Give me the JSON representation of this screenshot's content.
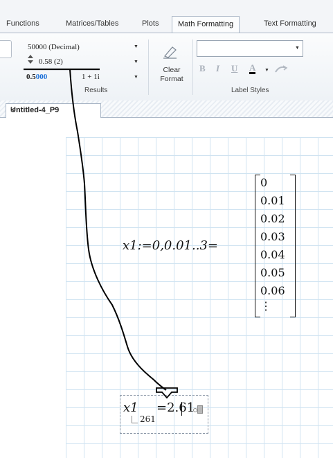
{
  "ribbon_tabs": [
    "Functions",
    "Matrices/Tables",
    "Plots",
    "Math Formatting",
    "Text Formatting"
  ],
  "active_tab": "Math Formatting",
  "results": {
    "format_combo": "50000 (Decimal)",
    "precision_value": "0.58 (2)",
    "preview_real_prefix": "0.5",
    "preview_real_suffix": "000",
    "preview_complex": "1 + 1i",
    "group_label": "Results"
  },
  "clear_format": {
    "line1": "Clear",
    "line2": "Format"
  },
  "label_styles": {
    "group_label": "Label Styles",
    "bold": "B",
    "italic": "I",
    "underline": "U",
    "color": "A"
  },
  "document": {
    "tab_title": "Untitled-4_P9",
    "close": "×"
  },
  "worksheet": {
    "definition": "x1:=0,0.01..3=",
    "matrix_values": [
      "0",
      "0.01",
      "0.02",
      "0.03",
      "0.04",
      "0.05",
      "0.06",
      "⋮"
    ],
    "eval_var": "x1",
    "eval_subscript": "261",
    "eval_result": "=2.61"
  },
  "colors": {
    "accent_blue": "#1a6fd8",
    "grid": "#cfe3f1"
  }
}
